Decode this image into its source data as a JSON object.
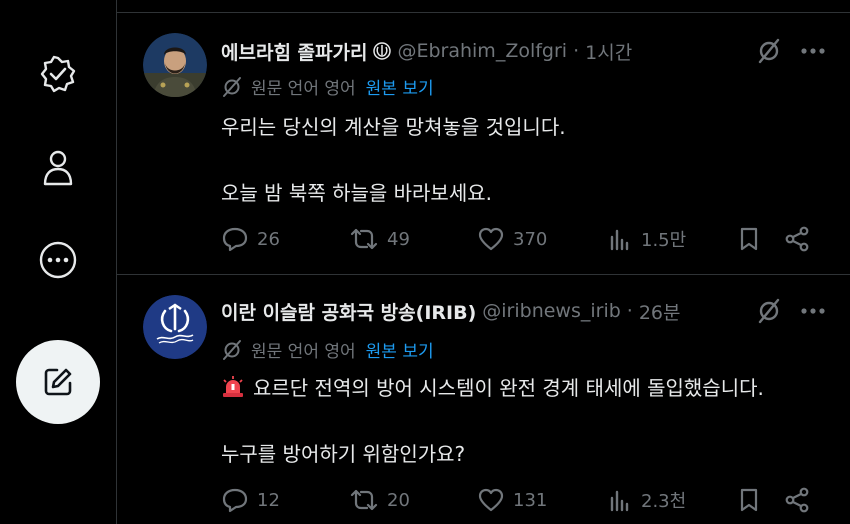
{
  "tweets": [
    {
      "name": "에브라힘 졸파가리",
      "handle": "@Ebrahim_Zolfgri",
      "time": "1시간",
      "translate_label": "원문 언어 영어",
      "translate_link": "원본 보기",
      "lines": [
        "우리는 당신의 계산을 망쳐놓을 것입니다.",
        "오늘 밤 북쪽 하늘을 바라보세요."
      ],
      "stats": {
        "replies": "26",
        "reposts": "49",
        "likes": "370",
        "views": "1.5만"
      }
    },
    {
      "name": "이란 이슬람 공화국 방송(IRIB)",
      "handle": "@iribnews_irib",
      "time": "26분",
      "translate_label": "원문 언어 영어",
      "translate_link": "원본 보기",
      "alert_emoji": "🚨",
      "lines": [
        "요르단 전역의 방어 시스템이 완전 경계 태세에 돌입했습니다.",
        "누구를 방어하기 위함인가요?"
      ],
      "stats": {
        "replies": "12",
        "reposts": "20",
        "likes": "131",
        "views": "2.3천"
      }
    }
  ],
  "icons": {
    "sidebar": [
      "verified-badge-icon",
      "profile-icon",
      "more-circle-icon",
      "compose-icon"
    ],
    "tweet_actions": [
      "reply-icon",
      "repost-icon",
      "like-icon",
      "views-icon",
      "bookmark-icon",
      "share-icon"
    ]
  }
}
